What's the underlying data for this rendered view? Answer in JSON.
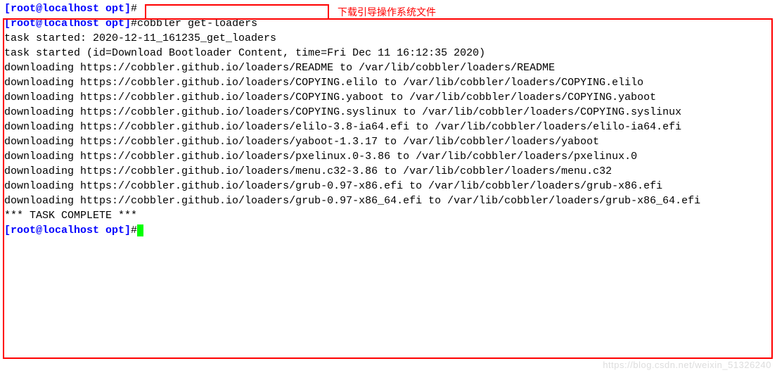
{
  "prompt_line0_partial": "[root@localhost opt]",
  "hash": "#",
  "prompt_line1": "[root@localhost opt]",
  "command": "cobbler get-loaders",
  "annotation_text": "下载引导操作系统文件",
  "output_lines": [
    "task started: 2020-12-11_161235_get_loaders",
    "task started (id=Download Bootloader Content, time=Fri Dec 11 16:12:35 2020)",
    "downloading https://cobbler.github.io/loaders/README to /var/lib/cobbler/loaders/README",
    "downloading https://cobbler.github.io/loaders/COPYING.elilo to /var/lib/cobbler/loaders/COPYING.elilo",
    "downloading https://cobbler.github.io/loaders/COPYING.yaboot to /var/lib/cobbler/loaders/COPYING.yaboot",
    "downloading https://cobbler.github.io/loaders/COPYING.syslinux to /var/lib/cobbler/loaders/COPYING.syslinux",
    "downloading https://cobbler.github.io/loaders/elilo-3.8-ia64.efi to /var/lib/cobbler/loaders/elilo-ia64.efi",
    "downloading https://cobbler.github.io/loaders/yaboot-1.3.17 to /var/lib/cobbler/loaders/yaboot",
    "downloading https://cobbler.github.io/loaders/pxelinux.0-3.86 to /var/lib/cobbler/loaders/pxelinux.0",
    "downloading https://cobbler.github.io/loaders/menu.c32-3.86 to /var/lib/cobbler/loaders/menu.c32",
    "downloading https://cobbler.github.io/loaders/grub-0.97-x86.efi to /var/lib/cobbler/loaders/grub-x86.efi",
    "downloading https://cobbler.github.io/loaders/grub-0.97-x86_64.efi to /var/lib/cobbler/loaders/grub-x86_64.efi",
    "*** TASK COMPLETE ***"
  ],
  "prompt_line2": "[root@localhost opt]",
  "watermark": "https://blog.csdn.net/weixin_51326240"
}
